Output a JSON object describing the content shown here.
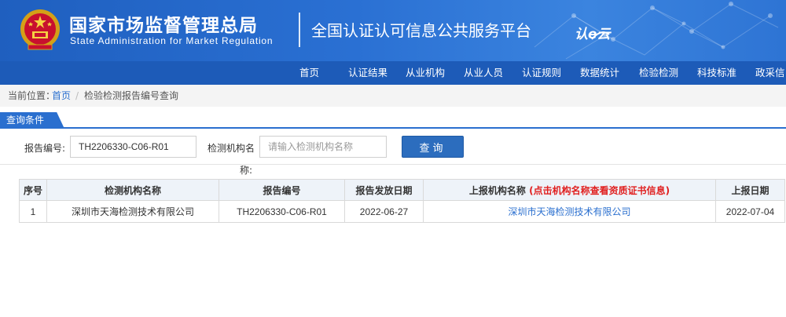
{
  "header": {
    "agency_name_zh": "国家市场监督管理总局",
    "agency_name_en": "State Administration  for  Market Regulation",
    "platform_title": "全国认证认可信息公共服务平台",
    "platform_logo_text": "认e云",
    "accent_color": "#2a6fcf"
  },
  "nav": {
    "items": [
      "首页",
      "认证结果",
      "从业机构",
      "从业人员",
      "认证规则",
      "数据统计",
      "检验检测",
      "科技标准",
      "政采信"
    ]
  },
  "breadcrumb": {
    "prefix": "当前位置：",
    "home": "首页",
    "separator": "/",
    "current": "检验检测报告编号查询"
  },
  "query": {
    "section_title": "查询条件",
    "report_no_label": "报告编号:",
    "report_no_value": "TH2206330-C06-R01",
    "org_label": "检测机构名",
    "org_label_wrap": "称:",
    "org_placeholder": "请输入检测机构名称",
    "submit_label": "查询"
  },
  "table": {
    "headers": {
      "seq": "序号",
      "org": "检测机构名称",
      "report_no": "报告编号",
      "issue_date": "报告发放日期",
      "reporting_org": "上报机构名称",
      "reporting_org_note": "(点击机构名称查看资质证书信息)",
      "report_date": "上报日期"
    },
    "rows": [
      {
        "seq": "1",
        "org": "深圳市天海检测技术有限公司",
        "report_no": "TH2206330-C06-R01",
        "issue_date": "2022-06-27",
        "reporting_org": "深圳市天海检测技术有限公司",
        "report_date": "2022-07-04"
      }
    ]
  }
}
